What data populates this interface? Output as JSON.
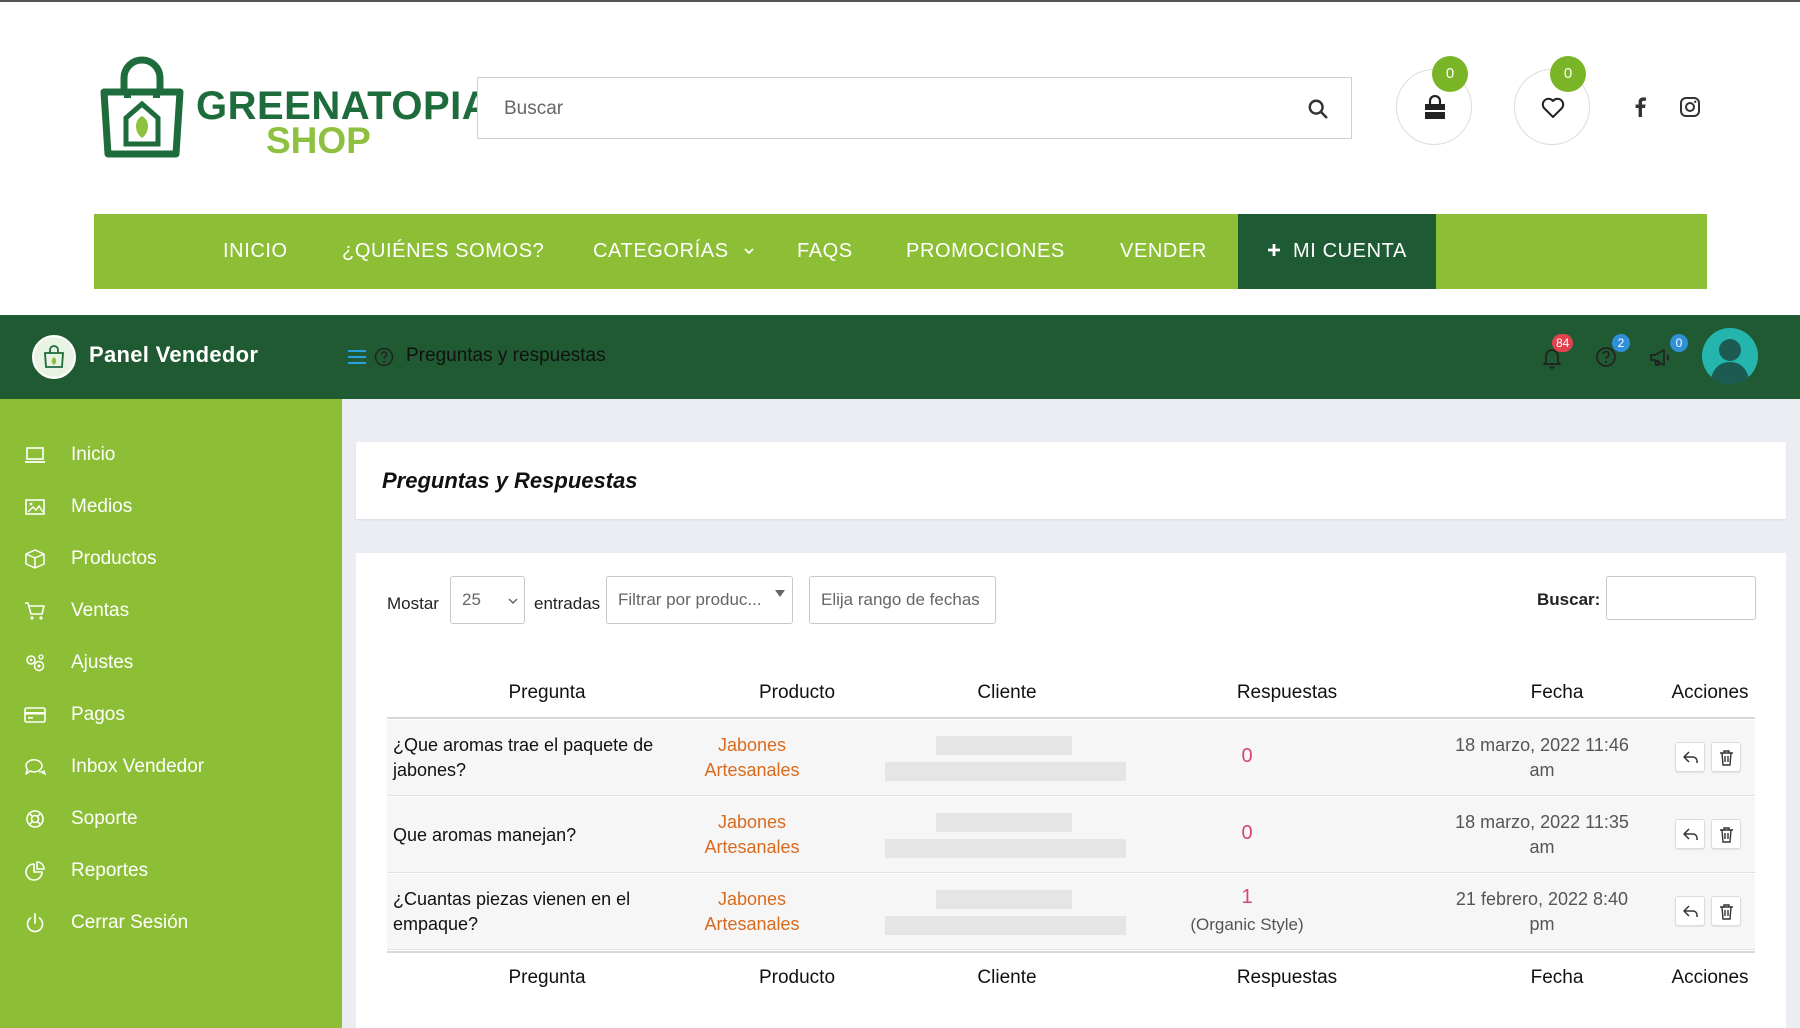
{
  "store": {
    "logo_line1": "GREENATOPIA",
    "logo_line2": "SHOP",
    "search_placeholder": "Buscar",
    "cart_count": "0",
    "wishlist_count": "0",
    "nav": [
      "INICIO",
      "¿QUIÉNES SOMOS?",
      "CATEGORÍAS",
      "FAQS",
      "PROMOCIONES",
      "VENDER"
    ],
    "account_label": "MI CUENTA"
  },
  "panel": {
    "title": "Panel Vendedor",
    "breadcrumb": "Preguntas y respuestas",
    "notifications_count": "84",
    "questions_count": "2",
    "announcements_count": "0"
  },
  "sidebar": {
    "items": [
      {
        "label": "Inicio",
        "icon": "laptop-icon"
      },
      {
        "label": "Medios",
        "icon": "image-icon"
      },
      {
        "label": "Productos",
        "icon": "box-icon"
      },
      {
        "label": "Ventas",
        "icon": "cart-icon"
      },
      {
        "label": "Ajustes",
        "icon": "settings-icon"
      },
      {
        "label": "Pagos",
        "icon": "credit-card-icon"
      },
      {
        "label": "Inbox Vendedor",
        "icon": "chat-icon"
      },
      {
        "label": "Soporte",
        "icon": "lifebuoy-icon"
      },
      {
        "label": "Reportes",
        "icon": "pie-chart-icon"
      },
      {
        "label": "Cerrar Sesión",
        "icon": "power-icon"
      }
    ]
  },
  "page": {
    "heading": "Preguntas y Respuestas",
    "show_label": "Mostar",
    "entries_value": "25",
    "entries_label": "entradas",
    "product_filter_placeholder": "Filtrar por produc...",
    "date_range_placeholder": "Elija rango de fechas",
    "search_label": "Buscar:",
    "search_value": ""
  },
  "table": {
    "headers": [
      "Pregunta",
      "Producto",
      "Cliente",
      "Respuestas",
      "Fecha",
      "Acciones"
    ],
    "rows": [
      {
        "question": "¿Que aromas trae el paquete de jabones?",
        "product": "Jabones Artesanales",
        "answers": "0",
        "answers_note": "",
        "date": "18 marzo, 2022 11:46 am"
      },
      {
        "question": "Que aromas manejan?",
        "product": "Jabones Artesanales",
        "answers": "0",
        "answers_note": "",
        "date": "18 marzo, 2022 11:35 am"
      },
      {
        "question": "¿Cuantas piezas vienen en el empaque?",
        "product": "Jabones Artesanales",
        "answers": "1",
        "answers_note": "(Organic Style)",
        "date": "21 febrero, 2022 8:40 pm"
      }
    ]
  },
  "colors": {
    "nav_green": "#8dbf36",
    "dark_green": "#1f5a32",
    "product_link": "#d86a1e",
    "answer_count": "#d8437a"
  }
}
